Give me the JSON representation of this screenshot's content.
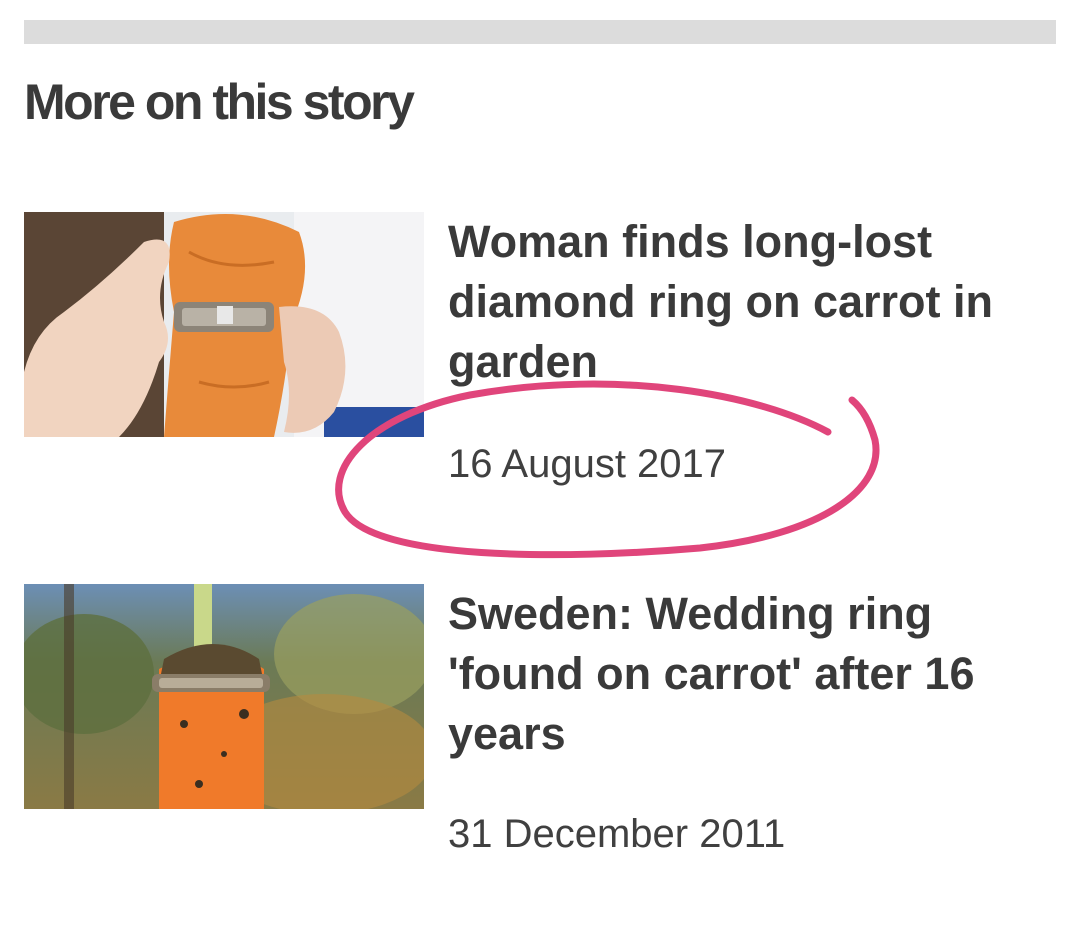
{
  "section": {
    "title": "More on this story"
  },
  "stories": [
    {
      "headline": "Woman finds long-lost diamond ring on carrot in garden",
      "date": "16 August 2017"
    },
    {
      "headline": "Sweden: Wedding ring 'found on carrot' after 16 years",
      "date": "31 December 2011"
    }
  ],
  "colors": {
    "text": "#3a3a3a",
    "divider": "#dcdcdc",
    "annotation": "#e0457b"
  }
}
